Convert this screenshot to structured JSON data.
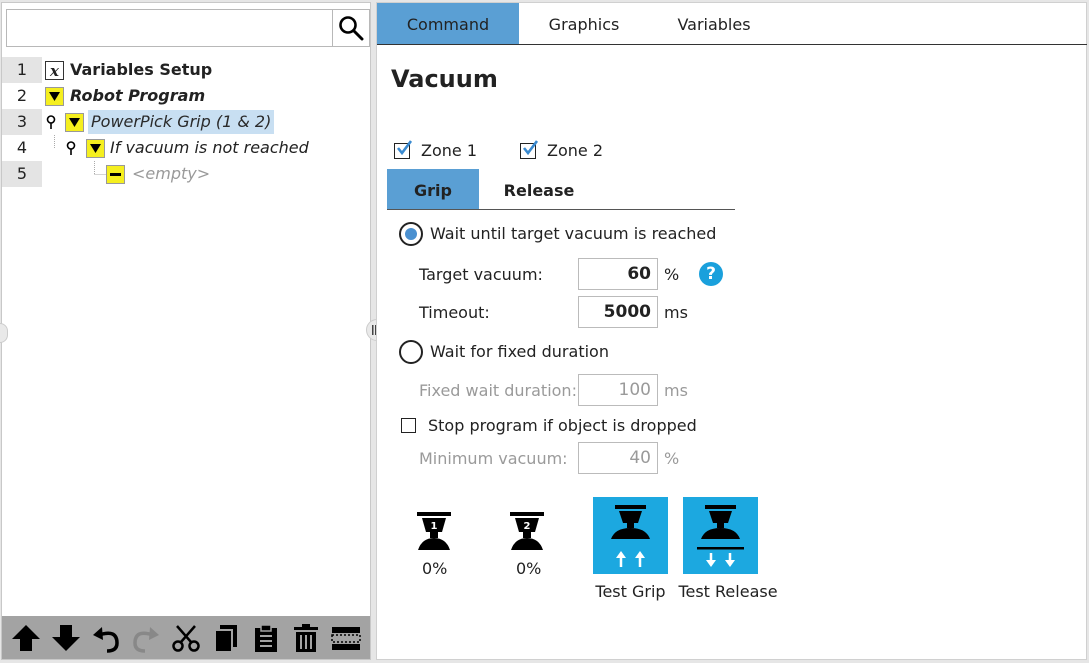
{
  "program_tree": {
    "search_placeholder": "",
    "rows": [
      {
        "num": "1",
        "label": "Variables Setup",
        "style": "bold"
      },
      {
        "num": "2",
        "label": "Robot Program",
        "style": "bold-italic"
      },
      {
        "num": "3",
        "label": "PowerPick Grip  (1 & 2)",
        "style": "italic-selected"
      },
      {
        "num": "4",
        "label": "If vacuum is not reached",
        "style": "italic"
      },
      {
        "num": "5",
        "label": "<empty>",
        "style": "italic-dim"
      }
    ],
    "variables_icon_glyph": "x"
  },
  "top_tabs": {
    "command": "Command",
    "graphics": "Graphics",
    "variables": "Variables",
    "active": "Command"
  },
  "vacuum": {
    "title": "Vacuum",
    "zone1": {
      "label": "Zone 1",
      "checked": true
    },
    "zone2": {
      "label": "Zone 2",
      "checked": true
    },
    "sub_tabs": {
      "grip": "Grip",
      "release": "Release",
      "active": "Grip"
    },
    "wait_target": {
      "label": "Wait until target vacuum is reached",
      "selected": true
    },
    "target_vacuum": {
      "label": "Target vacuum:",
      "value": "60",
      "unit": "%"
    },
    "help_glyph": "?",
    "timeout": {
      "label": "Timeout:",
      "value": "5000",
      "unit": "ms"
    },
    "wait_fixed": {
      "label": "Wait for fixed duration",
      "selected": false
    },
    "fixed_wait": {
      "label": "Fixed wait duration:",
      "value": "100",
      "unit": "ms"
    },
    "stop_program": {
      "label": "Stop program if object is dropped",
      "checked": false
    },
    "min_vacuum": {
      "label": "Minimum vacuum:",
      "value": "40",
      "unit": "%"
    },
    "zone1_reading": {
      "badge": "1",
      "percent": "0%"
    },
    "zone2_reading": {
      "badge": "2",
      "percent": "0%"
    },
    "test_grip": "Test Grip",
    "test_release": "Test Release"
  },
  "colors": {
    "accent": "#5a9fd4",
    "test_button": "#1ca8e0",
    "folder_icon": "#f5ef1f",
    "help_icon": "#1aa0dc",
    "toolbar": "#a3a3a3"
  },
  "toolbar_icons": [
    "move-up-icon",
    "move-down-icon",
    "undo-icon",
    "redo-icon",
    "cut-icon",
    "copy-icon",
    "paste-icon",
    "delete-icon",
    "suppress-icon"
  ]
}
